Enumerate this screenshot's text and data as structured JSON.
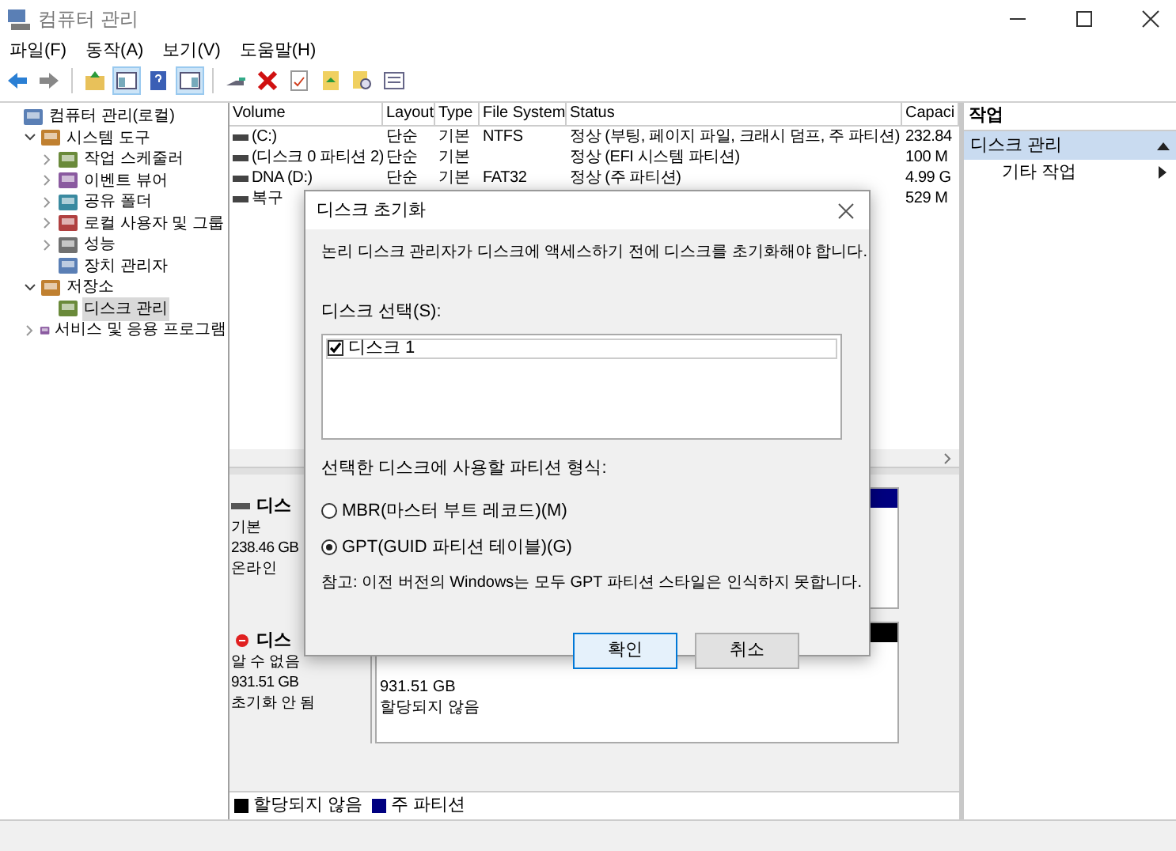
{
  "window": {
    "title": "컴퓨터 관리"
  },
  "menu": [
    "파일(F)",
    "동작(A)",
    "보기(V)",
    "도움말(H)"
  ],
  "toolbar": [
    {
      "pressed": false
    },
    {
      "pressed": false
    },
    {
      "pressed": false
    },
    {
      "pressed": true
    },
    {
      "pressed": false
    },
    {
      "pressed": true
    },
    {
      "pressed": false
    },
    {
      "pressed": false
    },
    {
      "pressed": false
    },
    {
      "pressed": false
    },
    {
      "pressed": false
    },
    {
      "pressed": false
    }
  ],
  "tree": [
    {
      "label": "컴퓨터 관리(로컬)",
      "selected": false,
      "children": [
        {
          "label": "시스템 도구",
          "expanded": true,
          "selected": false,
          "children": [
            {
              "label": "작업 스케줄러",
              "expanded": false,
              "selected": false
            },
            {
              "label": "이벤트 뷰어",
              "expanded": false,
              "selected": false
            },
            {
              "label": "공유 폴더",
              "expanded": false,
              "selected": false
            },
            {
              "label": "로컬 사용자 및 그룹",
              "expanded": false,
              "selected": false
            },
            {
              "label": "성능",
              "expanded": false,
              "selected": false
            },
            {
              "label": "장치 관리자",
              "selected": false
            }
          ]
        },
        {
          "label": "저장소",
          "expanded": true,
          "selected": false,
          "children": [
            {
              "label": "디스크 관리",
              "selected": true
            }
          ]
        },
        {
          "label": "서비스 및 응용 프로그램",
          "expanded": false,
          "selected": false
        }
      ]
    }
  ],
  "table": {
    "columns": [
      "Volume",
      "Layout",
      "Type",
      "File System",
      "Status",
      "Capaci"
    ],
    "rows": [
      {
        "volume": "(C:)",
        "layout": "단순",
        "type": "기본",
        "file_system": "NTFS",
        "status": "정상 (부팅, 페이지 파일, 크래시 덤프, 주 파티션)",
        "capacity": "232.84"
      },
      {
        "volume": "(디스크 0 파티션 2)",
        "layout": "단순",
        "type": "기본",
        "status": "정상 (EFI 시스템 파티션)",
        "capacity": "100 M"
      },
      {
        "volume": "DNA (D:)",
        "layout": "단순",
        "type": "기본",
        "file_system": "FAT32",
        "status": "정상 (주 파티션)",
        "capacity": "4.99 G"
      },
      {
        "volume": "복구",
        "capacity": "529 M"
      }
    ]
  },
  "disks": [
    {
      "name": "디스",
      "kind": "online",
      "lines": [
        "기본",
        "238.46 GB",
        "온라인"
      ],
      "partitions": [
        {
          "kind": "primary"
        }
      ]
    },
    {
      "name": "디스",
      "kind": "uninitialized",
      "lines": [
        "알 수 없음",
        "931.51 GB",
        "초기화 안 됨"
      ],
      "partitions": [
        {
          "kind": "unallocated",
          "lines": [
            "931.51 GB",
            "할당되지 않음"
          ]
        }
      ]
    }
  ],
  "legend": [
    {
      "label": "할당되지 않음",
      "color": "#000000"
    },
    {
      "label": "주 파티션",
      "color": "#000080"
    }
  ],
  "actions": {
    "title": "작업",
    "section": {
      "label": "디스크 관리",
      "expanded": true
    },
    "items": [
      {
        "label": "기타 작업"
      }
    ]
  },
  "dialog": {
    "title": "디스크 초기화",
    "message": "논리 디스크 관리자가 디스크에 액세스하기 전에 디스크를 초기화해야 합니다.",
    "disk_label": "디스크 선택(S):",
    "disks": [
      {
        "label": "디스크 1",
        "checked": true
      }
    ],
    "style_label": "선택한 디스크에 사용할 파티션 형식:",
    "options": [
      {
        "label": "MBR(마스터 부트 레코드)(M)",
        "selected": false
      },
      {
        "label": "GPT(GUID 파티션 테이블)(G)",
        "selected": true
      }
    ],
    "note": "참고: 이전 버전의 Windows는 모두 GPT 파티션 스타일은 인식하지 못합니다.",
    "buttons": [
      {
        "label": "확인",
        "default": true
      },
      {
        "label": "취소",
        "default": false
      }
    ]
  }
}
